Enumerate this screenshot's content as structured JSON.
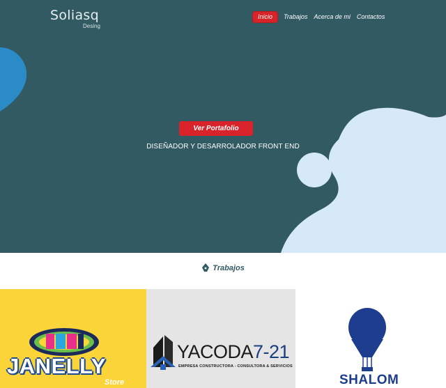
{
  "brand": {
    "name": "Soliasq",
    "tagline": "Desing"
  },
  "nav": {
    "items": [
      {
        "label": "Inicio",
        "active": true
      },
      {
        "label": "Trabajos",
        "active": false
      },
      {
        "label": "Acerca de mi",
        "active": false
      },
      {
        "label": "Contactos",
        "active": false
      }
    ]
  },
  "hero": {
    "cta_label": "Ver Portafolio",
    "subtitle": "DISEÑADOR Y DESARROLADOR FRONT END"
  },
  "works": {
    "section_title": "Trabajos",
    "icon": "pen-nib-icon",
    "cards": [
      {
        "name": "JANELLY",
        "sub": "Store"
      },
      {
        "name": "YACODA",
        "number": "7-21",
        "tagline": "EMPRESA CONSTRUCTORA - CONSULTORA & SERVICIOS"
      },
      {
        "name": "SHALOM"
      }
    ]
  },
  "colors": {
    "hero_bg": "#315a62",
    "accent": "#d8232a",
    "blob_light": "#d6e9f7",
    "blob_blue": "#2b8bc6"
  }
}
